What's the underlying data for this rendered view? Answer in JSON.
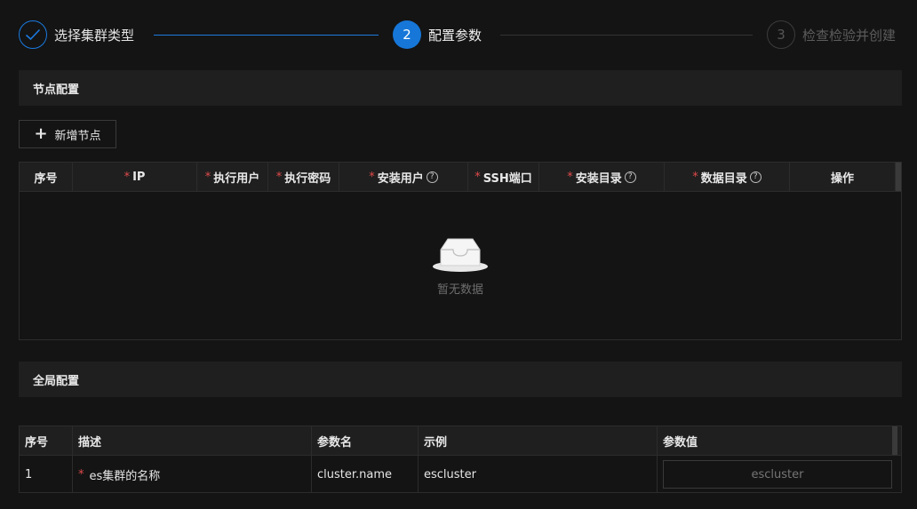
{
  "steps": [
    {
      "label": "选择集群类型",
      "number": "✓"
    },
    {
      "label": "配置参数",
      "number": "2"
    },
    {
      "label": "检查检验并创建",
      "number": "3"
    }
  ],
  "node_section": {
    "title": "节点配置",
    "add_button": "新增节点",
    "columns": [
      "序号",
      "IP",
      "执行用户",
      "执行密码",
      "安装用户",
      "SSH端口",
      "安装目录",
      "数据目录",
      "操作"
    ],
    "empty_text": "暂无数据"
  },
  "global_section": {
    "title": "全局配置",
    "columns": [
      "序号",
      "描述",
      "参数名",
      "示例",
      "参数值"
    ],
    "rows": [
      {
        "index": "1",
        "description": "es集群的名称",
        "param": "cluster.name",
        "example": "escluster",
        "value_placeholder": "escluster"
      }
    ]
  },
  "colors": {
    "accent": "#1677d8",
    "required": "#e04a4a",
    "background": "#141414"
  }
}
